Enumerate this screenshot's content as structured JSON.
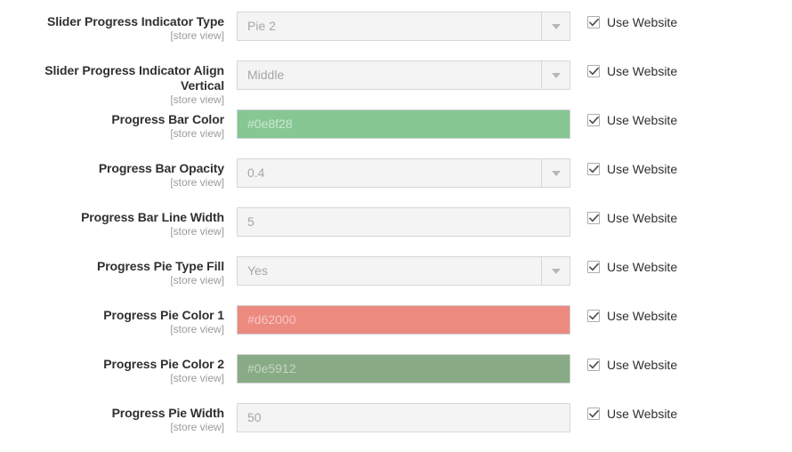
{
  "form": {
    "scope_note": "[store view]",
    "rows": [
      {
        "label": "Slider Progress Indicator Type",
        "scope": "[store view]",
        "control": {
          "kind": "select",
          "value": "Pie 2"
        },
        "inherit": {
          "label": "Use Website",
          "checked": true
        }
      },
      {
        "label": "Slider Progress Indicator Align Vertical",
        "scope": "[store view]",
        "control": {
          "kind": "select",
          "value": "Middle"
        },
        "inherit": {
          "label": "Use Website",
          "checked": true
        }
      },
      {
        "label": "Progress Bar Color",
        "scope": "[store view]",
        "control": {
          "kind": "color",
          "value": "#0e8f28",
          "swatch": "#86c794"
        },
        "inherit": {
          "label": "Use Website",
          "checked": true
        }
      },
      {
        "label": "Progress Bar Opacity",
        "scope": "[store view]",
        "control": {
          "kind": "select",
          "value": "0.4"
        },
        "inherit": {
          "label": "Use Website",
          "checked": true
        }
      },
      {
        "label": "Progress Bar Line Width",
        "scope": "[store view]",
        "control": {
          "kind": "text",
          "value": "5"
        },
        "inherit": {
          "label": "Use Website",
          "checked": true
        }
      },
      {
        "label": "Progress Pie Type Fill",
        "scope": "[store view]",
        "control": {
          "kind": "select",
          "value": "Yes"
        },
        "inherit": {
          "label": "Use Website",
          "checked": true
        }
      },
      {
        "label": "Progress Pie Color 1",
        "scope": "[store view]",
        "control": {
          "kind": "color",
          "value": "#d62000",
          "swatch": "#ec8a80"
        },
        "inherit": {
          "label": "Use Website",
          "checked": true
        }
      },
      {
        "label": "Progress Pie Color 2",
        "scope": "[store view]",
        "control": {
          "kind": "color",
          "value": "#0e5912",
          "swatch": "#88ab85"
        },
        "inherit": {
          "label": "Use Website",
          "checked": true
        }
      },
      {
        "label": "Progress Pie Width",
        "scope": "[store view]",
        "control": {
          "kind": "text",
          "value": "50"
        },
        "inherit": {
          "label": "Use Website",
          "checked": true
        }
      }
    ]
  },
  "icons": {
    "caret": "chevron-down-icon",
    "check": "checkmark-icon"
  },
  "colors": {
    "label_text": "#303030",
    "scope_text": "#9b9b9b",
    "field_bg": "#f4f4f4",
    "field_border": "#d6d6d6",
    "placeholder": "#a6a6a6",
    "check": "#514943"
  }
}
